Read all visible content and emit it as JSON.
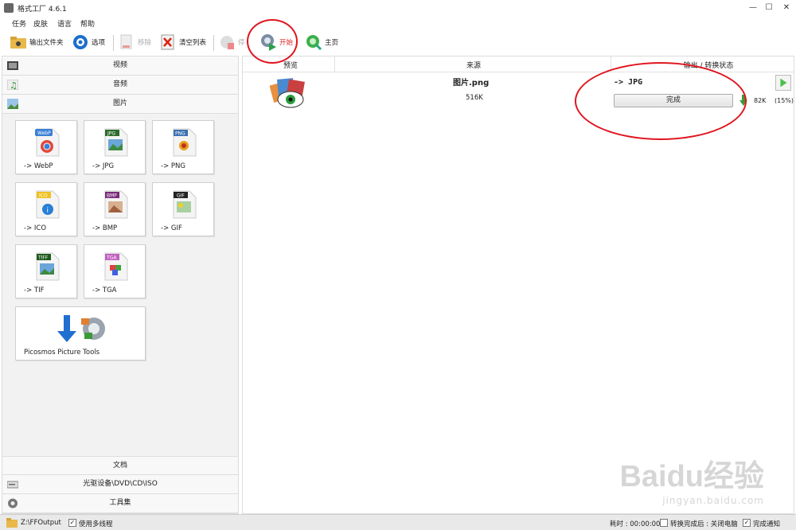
{
  "window": {
    "title": "格式工厂 4.6.1"
  },
  "menu": [
    "任务",
    "皮肤",
    "语言",
    "帮助"
  ],
  "toolbar": {
    "output_folder": "输出文件夹",
    "options": "选项",
    "remove": "移除",
    "clear_list": "清空列表",
    "stop": "停",
    "start": "开始",
    "home": "主页"
  },
  "categories": {
    "video": "视频",
    "audio": "音频",
    "picture": "图片",
    "document": "文档",
    "dvd": "光驱设备\\DVD\\CD\\ISO",
    "tools": "工具集"
  },
  "tiles": [
    {
      "label": "-> WebP",
      "badge": "WebP"
    },
    {
      "label": "-> JPG",
      "badge": "JPG"
    },
    {
      "label": "-> PNG",
      "badge": "PNG"
    },
    {
      "label": "-> ICO",
      "badge": "ICO"
    },
    {
      "label": "-> BMP",
      "badge": "BMP"
    },
    {
      "label": "-> GIF",
      "badge": "GIF"
    },
    {
      "label": "-> TIF",
      "badge": "TIFF"
    },
    {
      "label": "-> TGA",
      "badge": "TGA"
    },
    {
      "label": "Picosmos Picture Tools"
    }
  ],
  "table": {
    "headers": [
      "预览",
      "来源",
      "输出 / 转换状态"
    ],
    "row": {
      "filename": "图片.png",
      "size": "516K",
      "target": "-> JPG",
      "status": "完成",
      "output_size": "82K",
      "output_pct": "(15%)"
    }
  },
  "status": {
    "path": "Z:\\FFOutput",
    "multithread": "使用多线程",
    "elapsed": "耗时 : 00:00:00",
    "after_done": "转换完成后 : 关闭电脑",
    "notify": "完成通知"
  },
  "watermark": {
    "brand": "Baidu经验",
    "url": "jingyan.baidu.com"
  },
  "colors": {
    "accent_red": "#e0141e",
    "start_red": "#dd2222"
  }
}
